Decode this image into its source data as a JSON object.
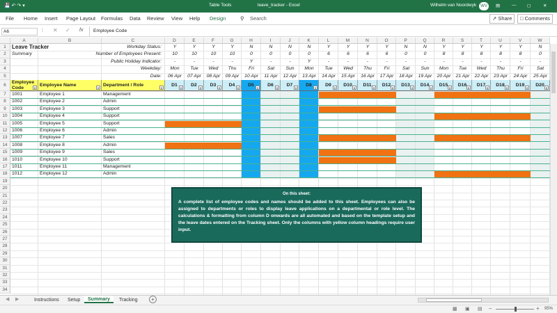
{
  "colors": {
    "accent": "#217346",
    "orange": "#f07213",
    "blue": "#16a8ef",
    "yellow": "#ffff66",
    "note_bg": "#1a6a5c",
    "weekend_fill": "#eaf1f1",
    "green_line": "#49b28b"
  },
  "window": {
    "filename": "leave_tracker",
    "app": "Excel",
    "separator": " - ",
    "table_tools": "Table Tools",
    "user": "Wilhelm van Noordwyk",
    "initials": "WV"
  },
  "menu": {
    "items": [
      "File",
      "Home",
      "Insert",
      "Page Layout",
      "Formulas",
      "Data",
      "Review",
      "View",
      "Help",
      "Design"
    ],
    "search": "Search",
    "share": "Share",
    "comments": "Comments"
  },
  "formula": {
    "name_box": "A6",
    "fx": "fx",
    "content": "Employee Code"
  },
  "col_letters": [
    "A",
    "B",
    "C",
    "D",
    "E",
    "F",
    "G",
    "H",
    "I",
    "J",
    "K",
    "L",
    "M",
    "N",
    "O",
    "P",
    "Q",
    "R",
    "S",
    "T",
    "U",
    "V",
    "W"
  ],
  "rows": [
    "1",
    "2",
    "3",
    "4",
    "5",
    "6",
    "7",
    "8",
    "9",
    "10",
    "11",
    "12",
    "13",
    "14",
    "15",
    "16",
    "17",
    "18",
    "19",
    "20",
    "21",
    "22",
    "23",
    "24",
    "25",
    "26",
    "27",
    "28",
    "29",
    "30",
    "31",
    "32",
    "33",
    "34"
  ],
  "top": {
    "title": "Leave Tracker",
    "subtitle": "Summary",
    "labels": [
      "Workday Status:",
      "Number of Employees Present:",
      "Public Holiday Indicator:",
      "Weekday:",
      "Date:"
    ]
  },
  "days": [
    {
      "ws": "Y",
      "n": "10",
      "ph": "-",
      "wd": "Mon",
      "date": "06 Apr",
      "h": "D1"
    },
    {
      "ws": "Y",
      "n": "10",
      "ph": "-",
      "wd": "Tue",
      "date": "07 Apr",
      "h": "D2"
    },
    {
      "ws": "Y",
      "n": "10",
      "ph": "-",
      "wd": "Wed",
      "date": "08 Apr",
      "h": "D3"
    },
    {
      "ws": "Y",
      "n": "10",
      "ph": "-",
      "wd": "Thu",
      "date": "09 Apr",
      "h": "D4"
    },
    {
      "ws": "N",
      "n": "0",
      "ph": "Y",
      "wd": "Fri",
      "date": "10 Apr",
      "h": "D5"
    },
    {
      "ws": "N",
      "n": "0",
      "ph": "-",
      "wd": "Sat",
      "date": "11 Apr",
      "h": "D6"
    },
    {
      "ws": "N",
      "n": "0",
      "ph": "-",
      "wd": "Sun",
      "date": "12 Apr",
      "h": "D7"
    },
    {
      "ws": "N",
      "n": "0",
      "ph": "Y",
      "wd": "Mon",
      "date": "13 Apr",
      "h": "D8"
    },
    {
      "ws": "Y",
      "n": "6",
      "ph": "-",
      "wd": "Tue",
      "date": "14 Apr",
      "h": "D9"
    },
    {
      "ws": "Y",
      "n": "6",
      "ph": "-",
      "wd": "Wed",
      "date": "15 Apr",
      "h": "D10"
    },
    {
      "ws": "Y",
      "n": "6",
      "ph": "-",
      "wd": "Thu",
      "date": "16 Apr",
      "h": "D11"
    },
    {
      "ws": "Y",
      "n": "6",
      "ph": "-",
      "wd": "Fri",
      "date": "17 Apr",
      "h": "D12"
    },
    {
      "ws": "N",
      "n": "0",
      "ph": "-",
      "wd": "Sat",
      "date": "18 Apr",
      "h": "D13"
    },
    {
      "ws": "N",
      "n": "0",
      "ph": "-",
      "wd": "Sun",
      "date": "19 Apr",
      "h": "D14"
    },
    {
      "ws": "Y",
      "n": "8",
      "ph": "-",
      "wd": "Mon",
      "date": "20 Apr",
      "h": "D15"
    },
    {
      "ws": "Y",
      "n": "8",
      "ph": "-",
      "wd": "Tue",
      "date": "21 Apr",
      "h": "D16"
    },
    {
      "ws": "Y",
      "n": "8",
      "ph": "-",
      "wd": "Wed",
      "date": "22 Apr",
      "h": "D17"
    },
    {
      "ws": "Y",
      "n": "8",
      "ph": "-",
      "wd": "Thu",
      "date": "23 Apr",
      "h": "D18"
    },
    {
      "ws": "Y",
      "n": "8",
      "ph": "-",
      "wd": "Fri",
      "date": "24 Apr",
      "h": "D19"
    },
    {
      "ws": "N",
      "n": "0",
      "ph": "-",
      "wd": "Sat",
      "date": "25 Apr",
      "h": "D20"
    }
  ],
  "table": {
    "headers": [
      "Employee Code",
      "Employee Name",
      "Department / Role"
    ],
    "employees": [
      {
        "code": "1001",
        "name": "Employee 1",
        "dept": "Management"
      },
      {
        "code": "1002",
        "name": "Employee 2",
        "dept": "Admin"
      },
      {
        "code": "1003",
        "name": "Employee 3",
        "dept": "Support"
      },
      {
        "code": "1004",
        "name": "Employee 4",
        "dept": "Support"
      },
      {
        "code": "1005",
        "name": "Employee 5",
        "dept": "Support"
      },
      {
        "code": "1006",
        "name": "Employee 6",
        "dept": "Admin"
      },
      {
        "code": "1007",
        "name": "Employee 7",
        "dept": "Sales"
      },
      {
        "code": "1008",
        "name": "Employee 8",
        "dept": "Admin"
      },
      {
        "code": "1009",
        "name": "Employee 9",
        "dept": "Sales"
      },
      {
        "code": "1010",
        "name": "Employee 10",
        "dept": "Support"
      },
      {
        "code": "1011",
        "name": "Employee 11",
        "dept": "Management"
      },
      {
        "code": "1012",
        "name": "Employee 12",
        "dept": "Admin"
      }
    ],
    "leave": [
      [
        8,
        9,
        10,
        11,
        14,
        15,
        16,
        17,
        18
      ],
      [],
      [
        8,
        9,
        10,
        11
      ],
      [
        14,
        15,
        16,
        17,
        18
      ],
      [
        0,
        1,
        2,
        3
      ],
      [],
      [
        8,
        9,
        10,
        11,
        14,
        15,
        16,
        17,
        18
      ],
      [
        0,
        1,
        2,
        3
      ],
      [
        8,
        9,
        10,
        11
      ],
      [
        8,
        9,
        10,
        11
      ],
      [],
      [
        14,
        15,
        16,
        17,
        18
      ]
    ]
  },
  "note": {
    "title": "On this sheet:",
    "body": "A complete list of employee codes and names should be added to this sheet. Employees can also be assigned to departments or roles to display leave applications on a departmental or role level. The calculations & formatting from column D onwards are all automated and based on the template setup and the leave dates entered on the Tracking sheet. Only the columns with yellow column headings require user input."
  },
  "sheets": {
    "tabs": [
      "Instructions",
      "Setup",
      "Summary",
      "Tracking"
    ],
    "active": "Summary"
  },
  "status": {
    "zoom": "95%"
  }
}
